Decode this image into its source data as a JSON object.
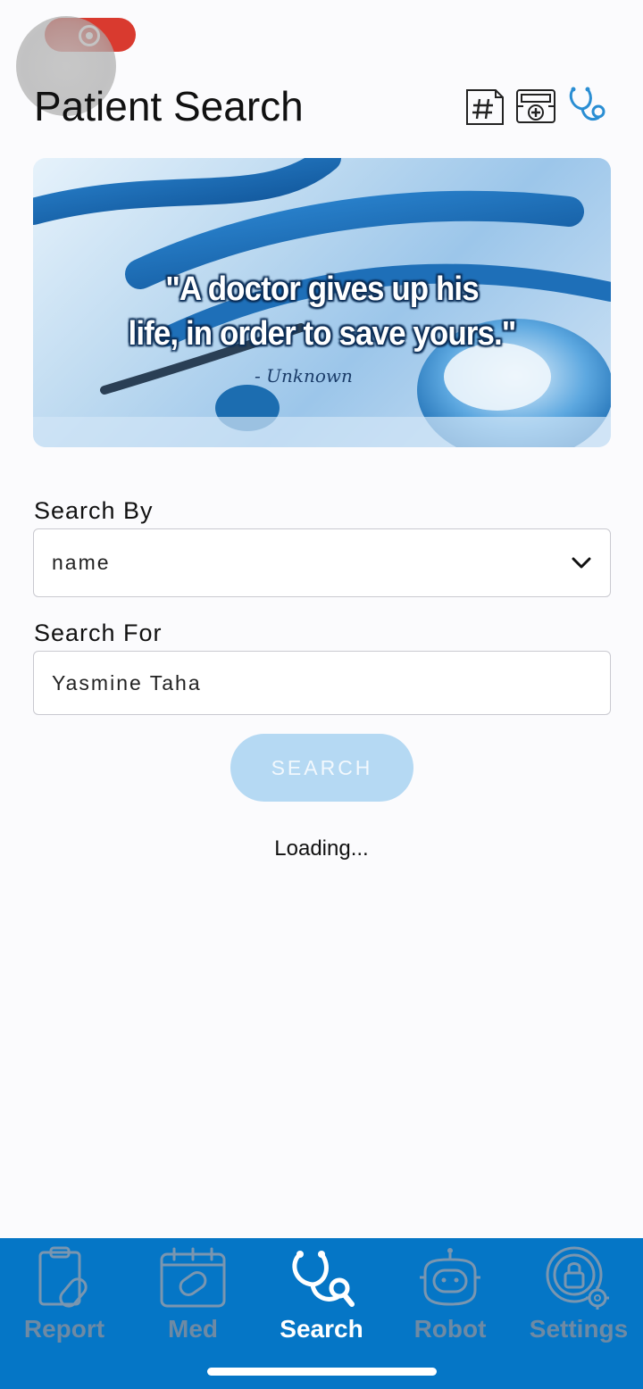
{
  "screen": {
    "title": "Patient Search",
    "header_icons": [
      "hashtag-icon",
      "medical-kit-icon",
      "stethoscope-icon"
    ]
  },
  "hero": {
    "quote_line1": "\"A doctor gives up his",
    "quote_line2": "life, in order to save yours.\"",
    "author": "- Unknown"
  },
  "form": {
    "search_by_label": "Search By",
    "search_by_value": "name",
    "search_for_label": "Search For",
    "search_for_value": "Yasmine Taha",
    "search_button": "SEARCH",
    "status": "Loading..."
  },
  "tabbar": {
    "items": [
      {
        "label": "Report",
        "icon": "clipboard-icon",
        "active": false
      },
      {
        "label": "Med",
        "icon": "calendar-pill-icon",
        "active": false
      },
      {
        "label": "Search",
        "icon": "stethoscope-icon",
        "active": true
      },
      {
        "label": "Robot",
        "icon": "robot-icon",
        "active": false
      },
      {
        "label": "Settings",
        "icon": "lock-gear-icon",
        "active": false
      }
    ]
  },
  "colors": {
    "accent": "#0576c6",
    "button_disabled": "#b5d9f3",
    "recording": "#d93a2f"
  }
}
